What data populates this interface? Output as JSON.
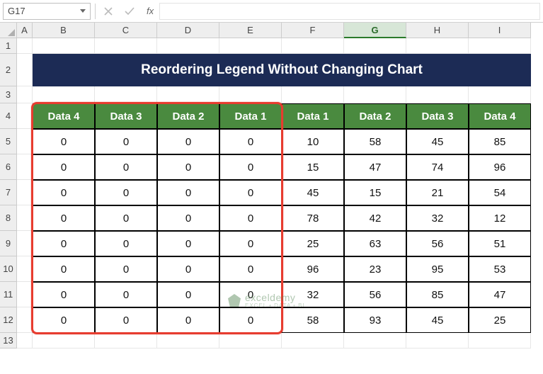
{
  "name_box": {
    "value": "G17"
  },
  "formula_bar": {
    "fx_label": "fx",
    "value": ""
  },
  "columns": [
    "A",
    "B",
    "C",
    "D",
    "E",
    "F",
    "G",
    "H",
    "I"
  ],
  "selected_column": "G",
  "row_numbers": [
    "1",
    "2",
    "3",
    "4",
    "5",
    "6",
    "7",
    "8",
    "9",
    "10",
    "11",
    "12",
    "13"
  ],
  "title_banner": "Reordering Legend Without Changing Chart",
  "table": {
    "headers_left": [
      "Data 4",
      "Data 3",
      "Data 2",
      "Data 1"
    ],
    "headers_right": [
      "Data 1",
      "Data 2",
      "Data 3",
      "Data 4"
    ],
    "rows_left": [
      [
        "0",
        "0",
        "0",
        "0"
      ],
      [
        "0",
        "0",
        "0",
        "0"
      ],
      [
        "0",
        "0",
        "0",
        "0"
      ],
      [
        "0",
        "0",
        "0",
        "0"
      ],
      [
        "0",
        "0",
        "0",
        "0"
      ],
      [
        "0",
        "0",
        "0",
        "0"
      ],
      [
        "0",
        "0",
        "0",
        "0"
      ],
      [
        "0",
        "0",
        "0",
        "0"
      ]
    ],
    "rows_right": [
      [
        "10",
        "58",
        "45",
        "85"
      ],
      [
        "15",
        "47",
        "74",
        "96"
      ],
      [
        "45",
        "15",
        "21",
        "54"
      ],
      [
        "78",
        "42",
        "32",
        "12"
      ],
      [
        "25",
        "63",
        "56",
        "51"
      ],
      [
        "96",
        "23",
        "95",
        "53"
      ],
      [
        "32",
        "56",
        "85",
        "47"
      ],
      [
        "58",
        "93",
        "45",
        "25"
      ]
    ]
  },
  "watermark": {
    "brand": "exceldemy",
    "tagline": "EXCEL • DATA • BI"
  }
}
